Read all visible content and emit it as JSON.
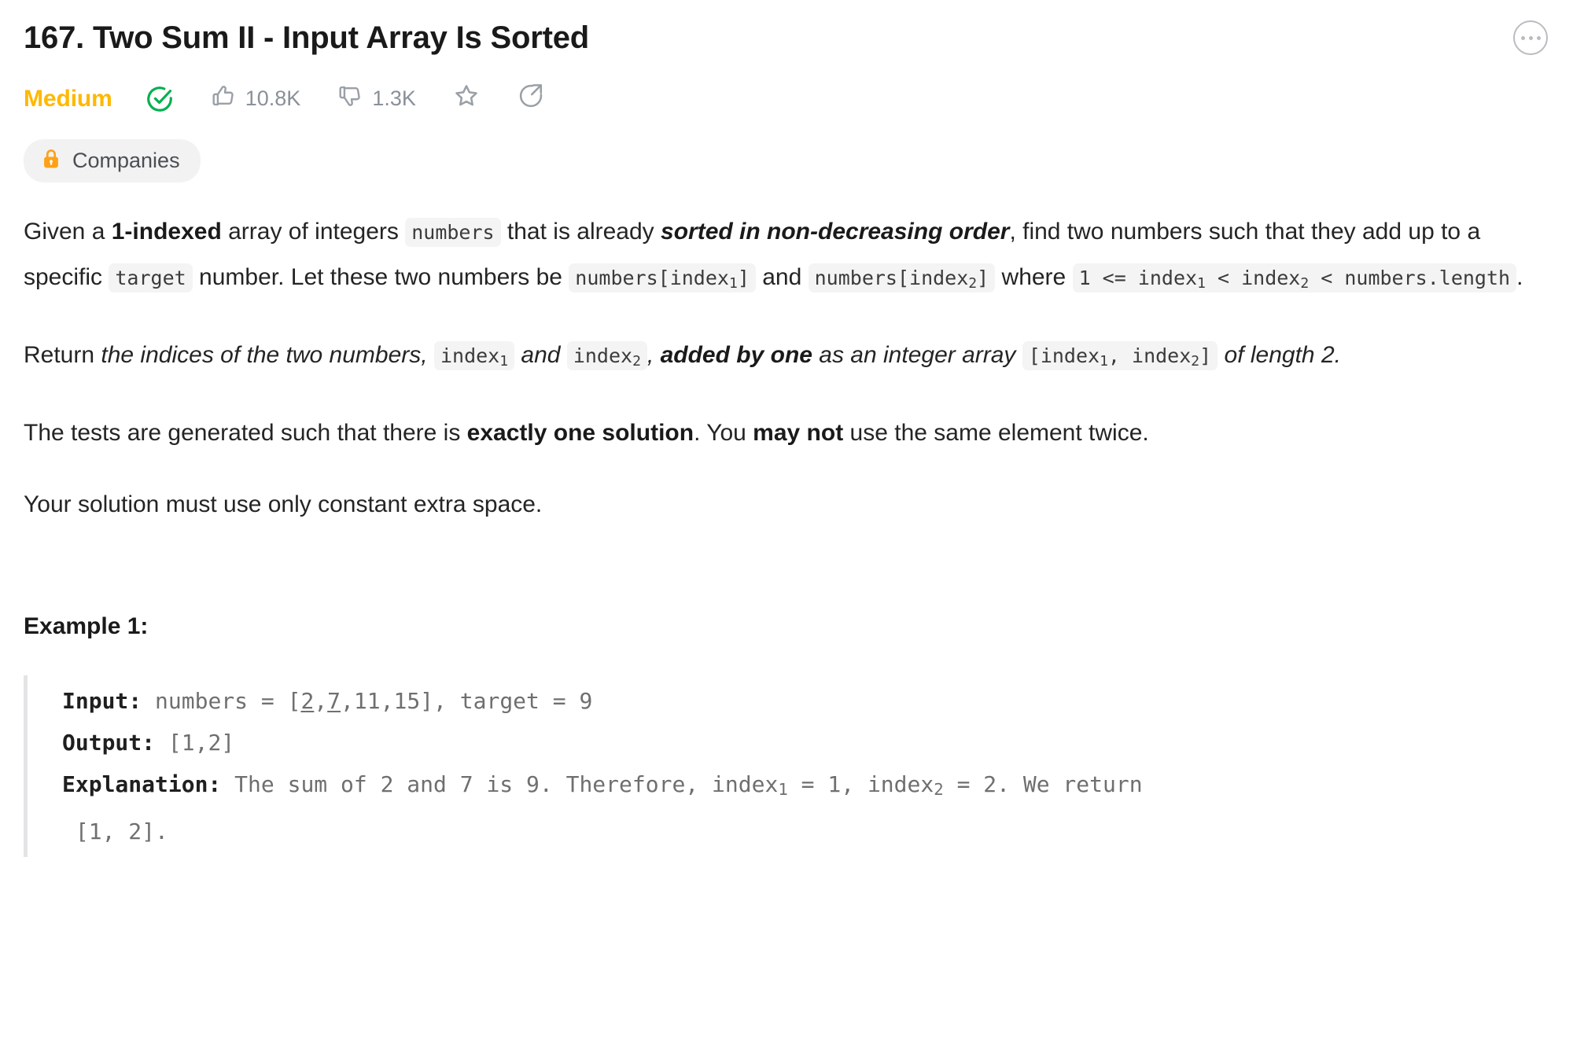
{
  "header": {
    "title": "167. Two Sum II - Input Array Is Sorted",
    "more_icon": "ellipsis-circle-icon"
  },
  "meta": {
    "difficulty": "Medium",
    "difficulty_color": "#ffb800",
    "solved_icon": "check-circle-icon",
    "solved_color": "#00b04f",
    "likes": {
      "icon": "thumbs-up-icon",
      "count": "10.8K"
    },
    "dislikes": {
      "icon": "thumbs-down-icon",
      "count": "1.3K"
    },
    "favorite_icon": "star-icon",
    "share_icon": "share-icon"
  },
  "companies": {
    "icon": "lock-icon",
    "label": "Companies",
    "lock_color": "#ffa116",
    "bg_color": "#f2f2f3"
  },
  "description": {
    "p1": {
      "s1": "Given a ",
      "b1": "1-indexed",
      "s2": " array of integers ",
      "c1": "numbers",
      "s3": " that is already ",
      "bi1": "sorted in non-decreasing order",
      "s4": ", find two numbers such that they add up to a specific ",
      "c2": "target",
      "s5": " number. Let these two numbers be ",
      "c3": "numbers[index",
      "c3sub": "1",
      "c3end": "]",
      "s6": " and ",
      "c4": "numbers[index",
      "c4sub": "2",
      "c4end": "]",
      "s7": " where ",
      "c5a": "1 <= index",
      "c5sub1": "1",
      "c5b": " < index",
      "c5sub2": "2",
      "c5c": " < numbers.length",
      "s8": "."
    },
    "p2": {
      "s1": "Return ",
      "i1": "the indices of the two numbers,",
      "c1": "index",
      "c1sub": "1",
      "i2": " and ",
      "c2": "index",
      "c2sub": "2",
      "i3": ", ",
      "bi1": "added by one",
      "i4": " as an integer array ",
      "c3a": "[index",
      "c3sub1": "1",
      "c3b": ", index",
      "c3sub2": "2",
      "c3c": "]",
      "i5": " of length 2."
    },
    "p3": {
      "s1": "The tests are generated such that there is ",
      "b1": "exactly one solution",
      "s2": ". You ",
      "b2": "may not",
      "s3": " use the same element twice."
    },
    "p4": "Your solution must use only constant extra space."
  },
  "example": {
    "heading": "Example 1:",
    "input_label": "Input:",
    "input_value_pre": " numbers = [",
    "input_underline_1": "2",
    "input_mid_1": ",",
    "input_underline_2": "7",
    "input_value_post": ",11,15], target = 9",
    "output_label": "Output:",
    "output_value": " [1,2]",
    "explanation_label": "Explanation:",
    "explanation_a": " The sum of 2 and 7 is 9. Therefore, index",
    "explanation_sub1": "1",
    "explanation_b": " = 1, index",
    "explanation_sub2": "2",
    "explanation_c": " = 2. We return",
    "explanation_d": "[1, 2]."
  }
}
